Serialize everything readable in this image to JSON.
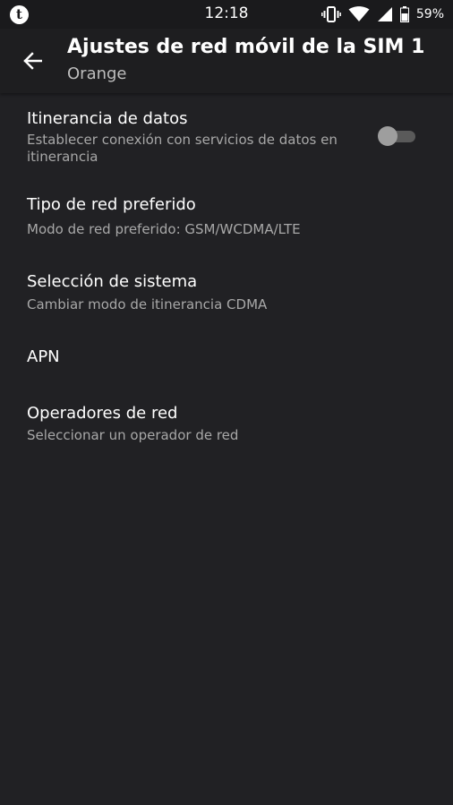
{
  "status_bar": {
    "time": "12:18",
    "battery_percent": "59%",
    "icons": [
      "app-notification-icon",
      "vibrate-icon",
      "wifi-icon",
      "signal-icon",
      "battery-icon"
    ]
  },
  "toolbar": {
    "title": "Ajustes de red móvil de la SIM 1",
    "subtitle": "Orange",
    "back_icon": "arrow-back-icon"
  },
  "settings": {
    "roaming": {
      "label": "Itinerancia de datos",
      "summary": "Establecer conexión con servicios de datos en itinerancia",
      "toggle_on": false
    },
    "network_type": {
      "label": "Tipo de red preferido",
      "summary": "Modo de red preferido: GSM/WCDMA/LTE"
    },
    "system_select": {
      "label": "Selección de sistema",
      "summary": "Cambiar modo de itinerancia CDMA"
    },
    "apn": {
      "label": "APN"
    },
    "operators": {
      "label": "Operadores de red",
      "summary": "Seleccionar un operador de red"
    }
  },
  "colors": {
    "background": "#212124",
    "toolbar": "#1e1e20",
    "status_bar": "#1a1a1c",
    "summary_text": "#a8a8a8"
  }
}
